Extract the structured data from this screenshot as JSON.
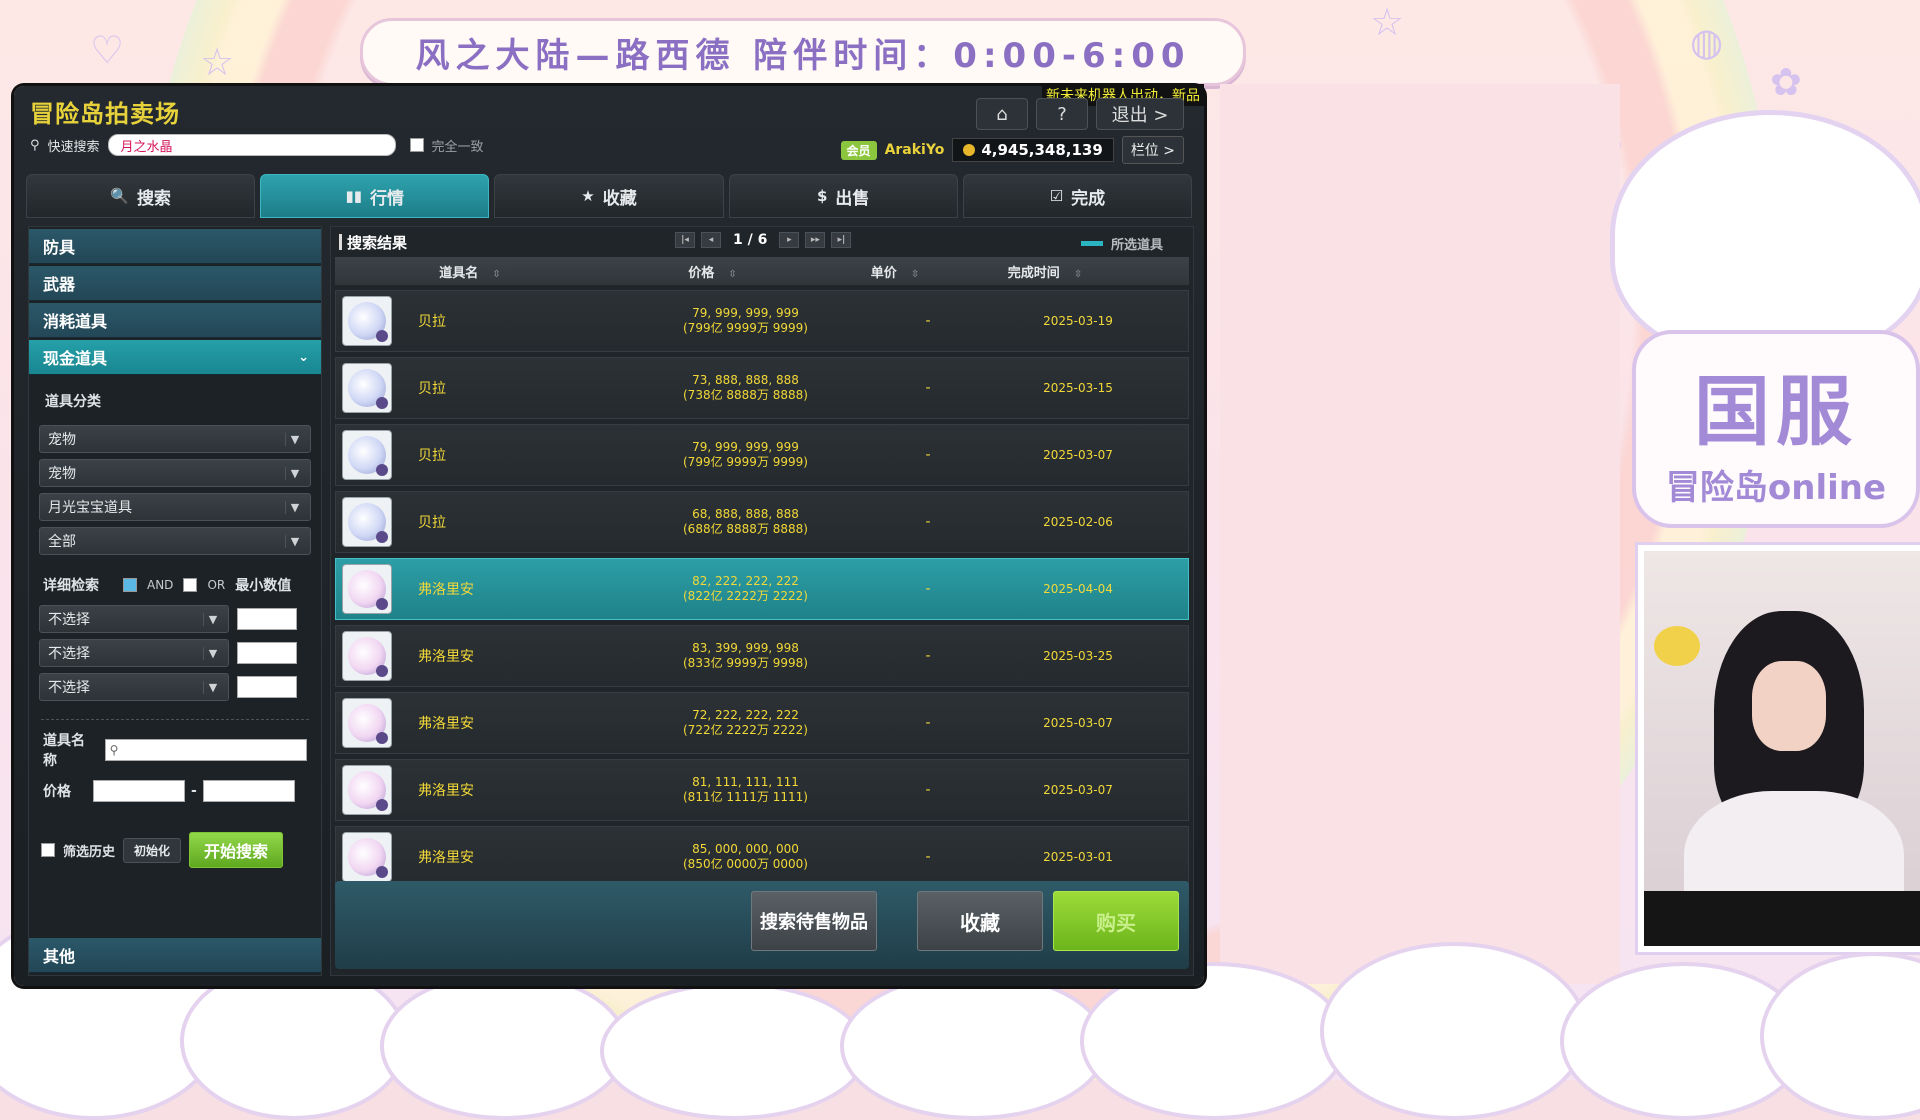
{
  "stream": {
    "banner": "风之大陆—路西德  陪伴时间：0:00-6:00",
    "badge_line1": "国服",
    "badge_line2": "冒险岛online"
  },
  "window": {
    "title": "冒险岛拍卖场",
    "marquee": "新未来机器人出动，新品",
    "exit_label": "退出 >",
    "top_icons": [
      "home-icon",
      "help-icon"
    ],
    "help_label": "?"
  },
  "search": {
    "quick_label": "快速搜索",
    "quick_value": "月之水晶",
    "exact_label": "完全一致"
  },
  "account": {
    "vip_label": "会员",
    "name": "ArakiYo",
    "mesos": "4,945,348,139",
    "slot_label": "栏位 >"
  },
  "tabs": [
    {
      "label": "搜索",
      "icon": "search-icon",
      "glyph": "🔍"
    },
    {
      "label": "行情",
      "icon": "chart-icon",
      "glyph": "▮▮"
    },
    {
      "label": "收藏",
      "icon": "star-icon",
      "glyph": "★"
    },
    {
      "label": "出售",
      "icon": "coin-icon",
      "glyph": "$"
    },
    {
      "label": "完成",
      "icon": "check-icon",
      "glyph": "☑"
    }
  ],
  "left": {
    "categories": [
      "防具",
      "武器",
      "消耗道具",
      "现金道具"
    ],
    "active_chevron": "⌄",
    "item_class_label": "道具分类",
    "dropdowns": [
      "宠物",
      "宠物",
      "月光宝宝道具",
      "全部"
    ],
    "detail_label": "详细检索",
    "and_label": "AND",
    "or_label": "OR",
    "min_label": "最小数值",
    "filters": [
      "不选择",
      "不选择",
      "不选择"
    ],
    "name_label": "道具名称",
    "price_label": "价格",
    "price_sep": "-",
    "history_label": "筛选历史",
    "init_label": "初始化",
    "start_label": "开始搜索",
    "other_label": "其他"
  },
  "results": {
    "title": "搜索结果",
    "page": "1 / 6",
    "legend": "所选道具",
    "columns": [
      "道具名",
      "价格",
      "单价",
      "完成时间"
    ],
    "rows": [
      {
        "name": "贝拉",
        "price1": "79, 999, 999, 999",
        "price2": "(799亿 9999万 9999)",
        "unit": "-",
        "date": "2025-03-19",
        "pink": false
      },
      {
        "name": "贝拉",
        "price1": "73, 888, 888, 888",
        "price2": "(738亿 8888万 8888)",
        "unit": "-",
        "date": "2025-03-15",
        "pink": false
      },
      {
        "name": "贝拉",
        "price1": "79, 999, 999, 999",
        "price2": "(799亿 9999万 9999)",
        "unit": "-",
        "date": "2025-03-07",
        "pink": false
      },
      {
        "name": "贝拉",
        "price1": "68, 888, 888, 888",
        "price2": "(688亿 8888万 8888)",
        "unit": "-",
        "date": "2025-02-06",
        "pink": false
      },
      {
        "name": "弗洛里安",
        "price1": "82, 222, 222, 222",
        "price2": "(822亿 2222万 2222)",
        "unit": "-",
        "date": "2025-04-04",
        "pink": true,
        "selected": true
      },
      {
        "name": "弗洛里安",
        "price1": "83, 399, 999, 998",
        "price2": "(833亿 9999万 9998)",
        "unit": "-",
        "date": "2025-03-25",
        "pink": true
      },
      {
        "name": "弗洛里安",
        "price1": "72, 222, 222, 222",
        "price2": "(722亿 2222万 2222)",
        "unit": "-",
        "date": "2025-03-07",
        "pink": true
      },
      {
        "name": "弗洛里安",
        "price1": "81, 111, 111, 111",
        "price2": "(811亿 1111万 1111)",
        "unit": "-",
        "date": "2025-03-07",
        "pink": true
      },
      {
        "name": "弗洛里安",
        "price1": "85, 000, 000, 000",
        "price2": "(850亿 0000万 0000)",
        "unit": "-",
        "date": "2025-03-01",
        "pink": true
      }
    ],
    "btn_search_pending": "搜索待售物品",
    "btn_favorite": "收藏",
    "btn_buy": "购买"
  },
  "colors": {
    "accent": "#2ea3ae",
    "price_text": "#f2d838",
    "buy_green": "#8ccc2e"
  }
}
